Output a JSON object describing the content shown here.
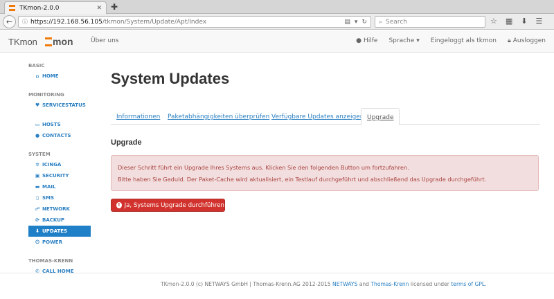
{
  "browser": {
    "tab_title": "TKmon-2.0.0",
    "tab_close": "✕",
    "new_tab": "✚",
    "url_host": "https://192.168.56.105",
    "url_path": "/tkmon/System/Update/Apt/Index",
    "search_placeholder": "Search"
  },
  "header": {
    "brand": "TKmon",
    "logo_text": "mon",
    "about": "Über uns",
    "help": "Hilfe",
    "language": "Sprache",
    "logged_in": "Eingeloggt als tkmon",
    "logout": "Ausloggen"
  },
  "sidebar": {
    "basic_header": "BASIC",
    "home": "HOME",
    "monitoring_header": "MONITORING",
    "servicestatus": "SERVICESTATUS",
    "hosts": "HOSTS",
    "contacts": "CONTACTS",
    "system_header": "SYSTEM",
    "icinga": "ICINGA",
    "security": "SECURITY",
    "mail": "MAIL",
    "sms": "SMS",
    "network": "NETWORK",
    "backup": "BACKUP",
    "updates": "UPDATES",
    "power": "POWER",
    "thomas_krenn_header": "THOMAS-KRENN",
    "call_home": "CALL HOME"
  },
  "main": {
    "title": "System Updates",
    "tabs": {
      "info": "Informationen",
      "deps": "Paketabhängigkeiten überprüfen",
      "available": "Verfügbare Updates anzeigen",
      "upgrade": "Upgrade"
    },
    "section_title": "Upgrade",
    "alert_line1": "Dieser Schritt führt ein Upgrade Ihres Systems aus. Klicken Sie den folgenden Button um fortzufahren.",
    "alert_line2": "Bitte haben Sie Geduld. Der Paket-Cache wird aktualisiert, ein Testlauf durchgeführt und abschließend das Upgrade durchgeführt.",
    "upgrade_button": "Ja, Systems Upgrade durchführen"
  },
  "footer": {
    "prefix": "TKmon-2.0.0 (c) NETWAYS GmbH | Thomas-Krenn.AG 2012-2015 ",
    "netways": "NETWAYS",
    "and": " and ",
    "thomas_krenn": "Thomas-Krenn",
    "licensed": " licensed under ",
    "terms": "terms of GPL",
    "suffix": "."
  },
  "colors": {
    "accent": "#1f7fc7",
    "logo_orange": "#f07b0a",
    "danger": "#d2322d",
    "alert_bg": "#f2dede",
    "alert_text": "#a94442"
  }
}
